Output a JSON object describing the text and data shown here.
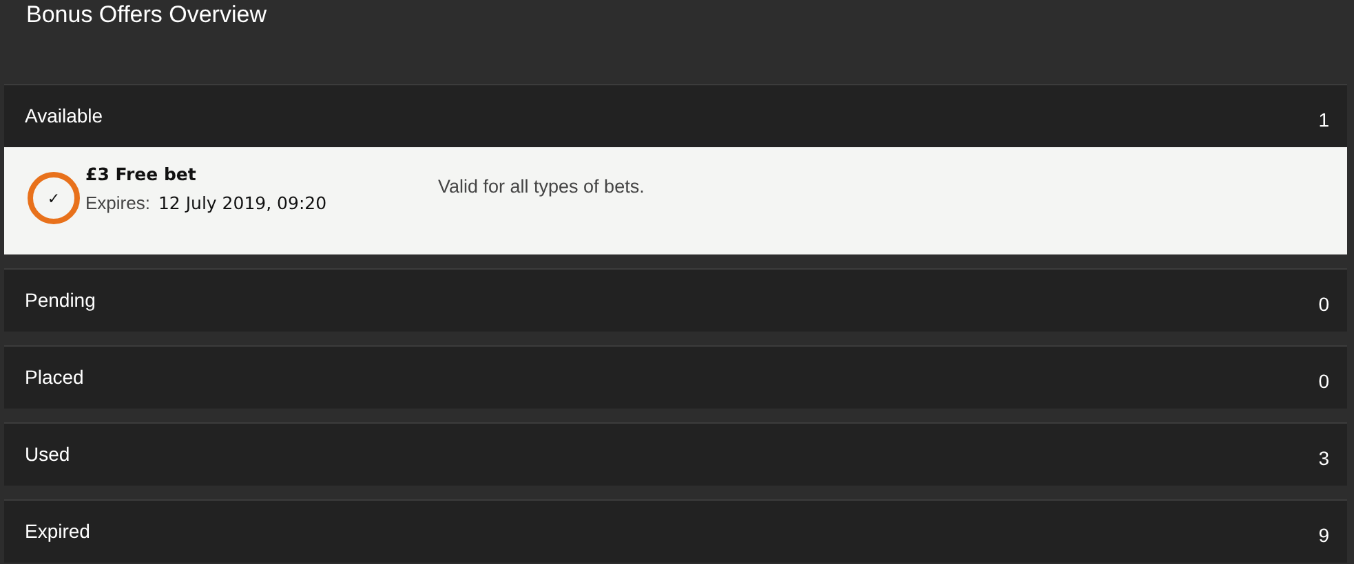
{
  "title": "Bonus Offers Overview",
  "sections": [
    {
      "label": "Available",
      "count": "1",
      "offers": [
        {
          "check": "✓",
          "name": "£3 Free bet",
          "expires_label": "Expires:",
          "expires_value": "12 July 2019, 09:20",
          "description": "Valid for all types of bets."
        }
      ]
    },
    {
      "label": "Pending",
      "count": "0"
    },
    {
      "label": "Placed",
      "count": "0"
    },
    {
      "label": "Used",
      "count": "3"
    },
    {
      "label": "Expired",
      "count": "9"
    }
  ]
}
